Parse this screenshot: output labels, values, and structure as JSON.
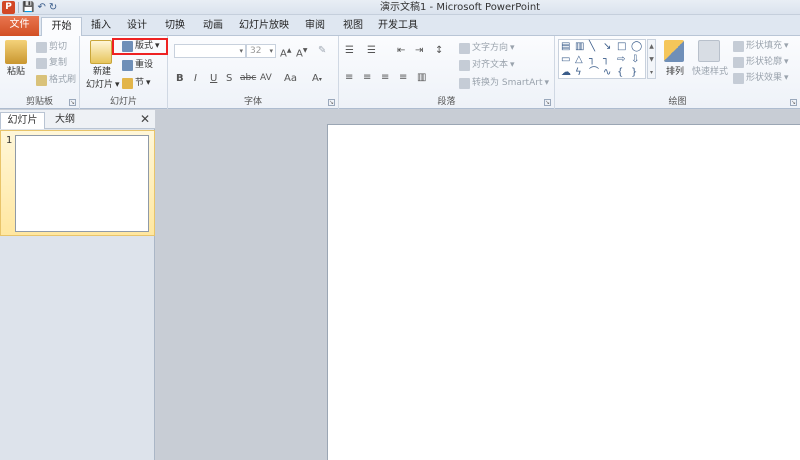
{
  "window": {
    "title": "演示文稿1 - Microsoft PowerPoint"
  },
  "qat": {
    "logo": "P",
    "save": "💾",
    "undo": "↶",
    "redo": "↻"
  },
  "tabs": [
    {
      "label": "文件"
    },
    {
      "label": "开始"
    },
    {
      "label": "插入"
    },
    {
      "label": "设计"
    },
    {
      "label": "切换"
    },
    {
      "label": "动画"
    },
    {
      "label": "幻灯片放映"
    },
    {
      "label": "审阅"
    },
    {
      "label": "视图"
    },
    {
      "label": "开发工具"
    }
  ],
  "clipboard": {
    "paste": "粘贴",
    "cut": "剪切",
    "copy": "复制",
    "format_painter": "格式刷",
    "group_label": "剪贴板"
  },
  "slides_group": {
    "new_slide_line1": "新建",
    "new_slide_line2": "幻灯片",
    "layout": "版式",
    "reset": "重设",
    "section": "节",
    "group_label": "幻灯片"
  },
  "font_group": {
    "font_size": "32",
    "bold": "B",
    "italic": "I",
    "underline": "U",
    "strike": "S",
    "abc": "abc",
    "av": "AV",
    "aa": "Aa",
    "group_label": "字体"
  },
  "paragraph_group": {
    "text_direction": "文字方向",
    "align_text": "对齐文本",
    "smartart": "转换为 SmartArt",
    "group_label": "段落"
  },
  "drawing_group": {
    "arrange": "排列",
    "quick_styles": "快速样式",
    "shape_fill": "形状填充",
    "shape_outline": "形状轮廓",
    "shape_effects": "形状效果",
    "group_label": "绘图"
  },
  "panel": {
    "tab_slides": "幻灯片",
    "tab_outline": "大纲",
    "close": "✕",
    "slide_number": "1"
  },
  "colors": {
    "file_tab": "#d24726",
    "highlight_box": "#ee2222"
  }
}
